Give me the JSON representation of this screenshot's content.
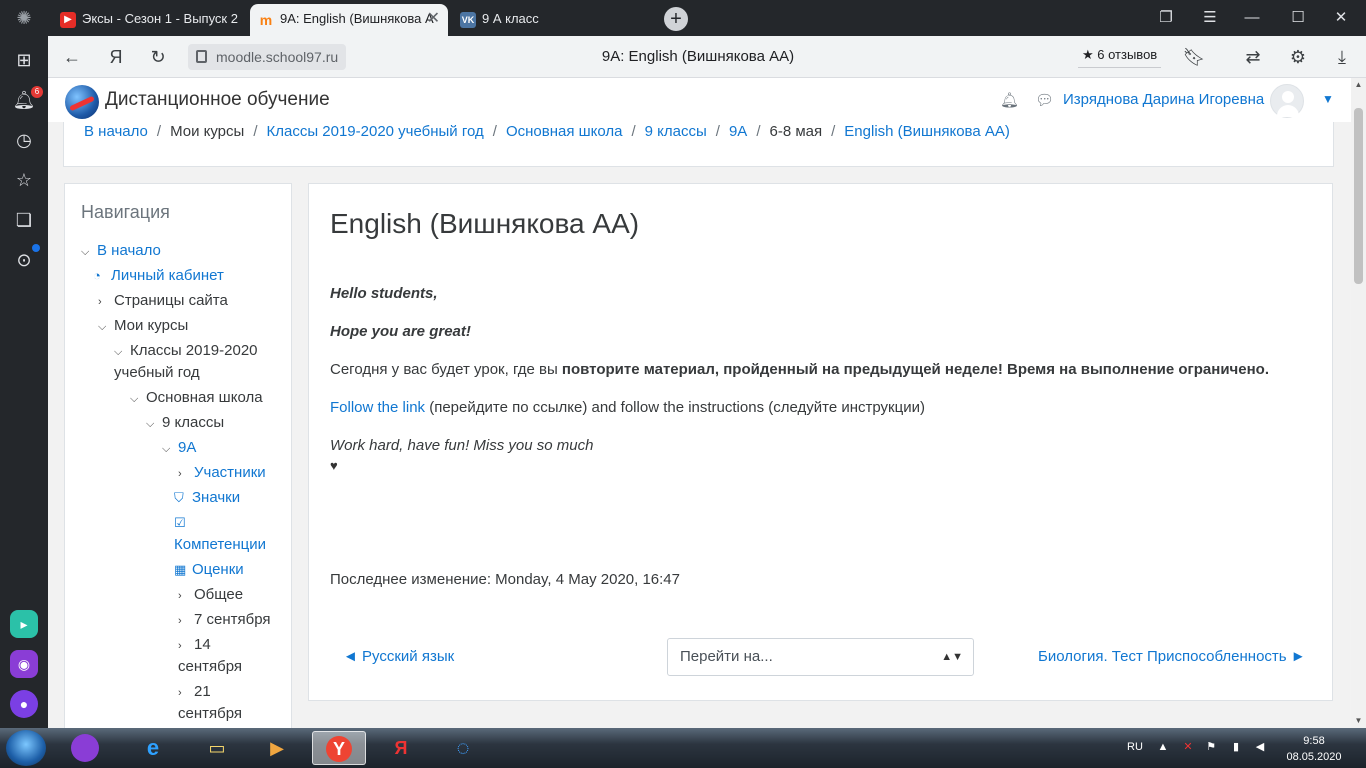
{
  "browser": {
    "tabs": [
      {
        "label": "Эксы - Сезон 1 - Выпуск 2",
        "icon": "youtube-icon"
      },
      {
        "label": "9А: English (Вишнякова А",
        "icon": "moodle-icon"
      },
      {
        "label": "9 А класс",
        "icon": "vk-icon"
      }
    ],
    "address": {
      "domain": "moodle.school97.ru",
      "page_title": "9А: English (Вишнякова АА)",
      "reviews": "★ 6 отзывов"
    },
    "sidebar_badge": "6"
  },
  "site": {
    "name": "Дистанционное обучение",
    "user": "Изряднова Дарина Игоревна"
  },
  "breadcrumb": [
    {
      "label": "В начало",
      "link": true
    },
    {
      "label": "Мои курсы",
      "link": false
    },
    {
      "label": "Классы 2019-2020 учебный год",
      "link": true
    },
    {
      "label": "Основная школа",
      "link": true
    },
    {
      "label": "9 классы",
      "link": true
    },
    {
      "label": "9А",
      "link": true
    },
    {
      "label": "6-8 мая",
      "link": false
    },
    {
      "label": "English (Вишнякова АА)",
      "link": true
    }
  ],
  "navigation": {
    "title": "Навигация",
    "home": "В начало",
    "dashboard": "Личный кабинет",
    "site_pages": "Страницы сайта",
    "my_courses": "Мои курсы",
    "classes_1": "Классы 2019-2020",
    "classes_2": "учебный год",
    "main_school": "Основная школа",
    "grade9": "9 классы",
    "class9a": "9А",
    "participants": "Участники",
    "badges": "Значки",
    "competencies": "Компетенции",
    "grades": "Оценки",
    "general": "Общее",
    "sep7": "7 сентября",
    "sep14_a": "14",
    "sep14_b": "сентября",
    "sep21_a": "21",
    "sep21_b": "сентября"
  },
  "content": {
    "title": "English (Вишнякова АА)",
    "greeting": "Hello students,",
    "hope": "Hope you are great!",
    "lesson_plain": "Сегодня у вас будет урок, где вы ",
    "lesson_bold": "повторите материал, пройденный на предыдущей неделе! Время на выполнение ограничено.",
    "follow_link": "Follow the link",
    "follow_rest": " (перейдите по ссылке) and follow the instructions (следуйте инструкции)",
    "closing": "Work hard, have fun! Miss you so much",
    "last_modified": "Последнее изменение: Monday, 4 May 2020, 16:47",
    "prev": "◄ Русский язык",
    "jump": "Перейти на...",
    "next": "Биология. Тест Приспособленность ►"
  },
  "taskbar": {
    "lang": "RU",
    "time": "9:58",
    "date": "08.05.2020"
  }
}
